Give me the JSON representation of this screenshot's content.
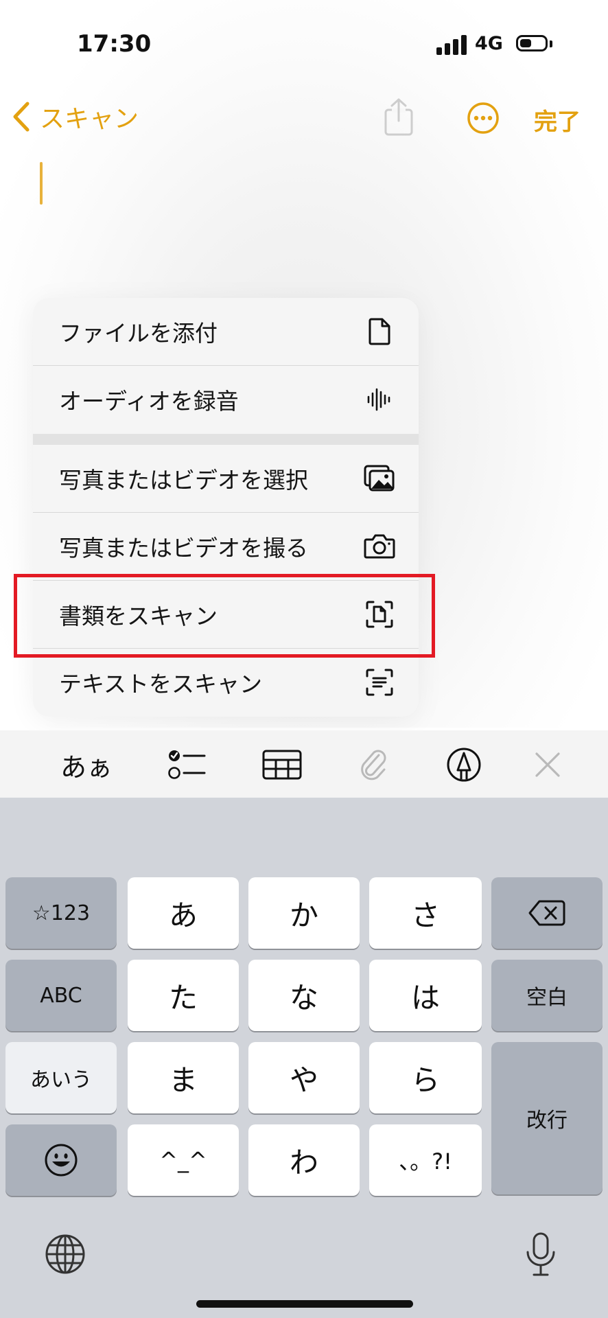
{
  "status_bar": {
    "time": "17:30",
    "network": "4G"
  },
  "nav": {
    "back_label": "スキャン",
    "done_label": "完了"
  },
  "menu": {
    "items": [
      {
        "label": "ファイルを添付",
        "icon": "doc-icon"
      },
      {
        "label": "オーディオを録音",
        "icon": "waveform-icon"
      },
      {
        "label": "写真またはビデオを選択",
        "icon": "photos-icon"
      },
      {
        "label": "写真またはビデオを撮る",
        "icon": "camera-icon"
      },
      {
        "label": "書類をスキャン",
        "icon": "doc-scan-icon"
      },
      {
        "label": "テキストをスキャン",
        "icon": "text-scan-icon"
      }
    ],
    "highlighted_item": "書類をスキャン"
  },
  "toolbar": {
    "format_label": "あぁ",
    "icons": [
      "checklist-icon",
      "table-icon",
      "paperclip-icon",
      "markup-pen-icon",
      "close-icon"
    ]
  },
  "keyboard": {
    "symbols": "☆123",
    "abc": "ABC",
    "kana": "あいう",
    "keys": [
      "あ",
      "か",
      "さ",
      "た",
      "な",
      "は",
      "ま",
      "や",
      "ら",
      "^_^",
      "わ",
      "、。?!"
    ],
    "space": "空白",
    "return": "改行"
  },
  "colors": {
    "accent": "#e3a110",
    "highlight_box": "#e31a24",
    "keyboard_bg": "#d1d4da"
  }
}
